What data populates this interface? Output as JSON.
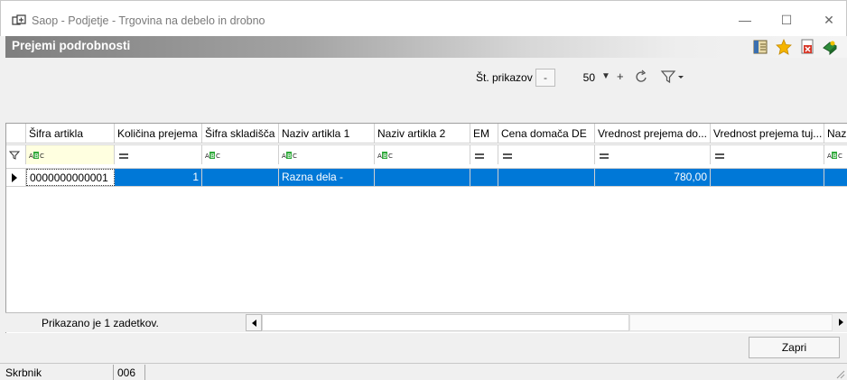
{
  "window": {
    "title": "Saop  - Podjetje - Trgovina na debelo in drobno",
    "buttons": {
      "minimize": "—",
      "maximize": "☐",
      "close": "✕"
    }
  },
  "panel": {
    "title": "Prejemi podrobnosti",
    "toolbar_icons": [
      "columns-icon",
      "favorite-star-icon",
      "export-icon",
      "help-book-icon"
    ]
  },
  "pager": {
    "label": "Št. prikazov",
    "minus": "-",
    "value": "50",
    "plus": "+"
  },
  "grid": {
    "columns": [
      "Šifra artikla",
      "Količina prejema",
      "Šifra skladišča",
      "Naziv artikla 1",
      "Naziv artikla 2",
      "EM",
      "Cena domača DE",
      "Vrednost prejema do...",
      "Vrednost prejema tuj...",
      "Naziv"
    ],
    "filter_types": [
      "text",
      "number",
      "text",
      "text",
      "text",
      "number",
      "number",
      "number",
      "number",
      "text"
    ],
    "rows": [
      {
        "sifra_artikla": "0000000000001",
        "kolicina_prejema": "1",
        "sifra_skladisca": "",
        "naziv_artikla_1": "Razna dela -",
        "naziv_artikla_2": "",
        "em": "",
        "cena_domaca": "",
        "vrednost_domaca": "780,00",
        "vrednost_tuja": "",
        "naziv": ""
      }
    ],
    "status": "Prikazano je 1 zadetkov."
  },
  "actions": {
    "close_label": "Zapri"
  },
  "statusbar": {
    "user": "Skrbnik",
    "code": "006"
  },
  "colors": {
    "selection": "#0078d7",
    "header_gradient_start": "#7f7f7f"
  }
}
